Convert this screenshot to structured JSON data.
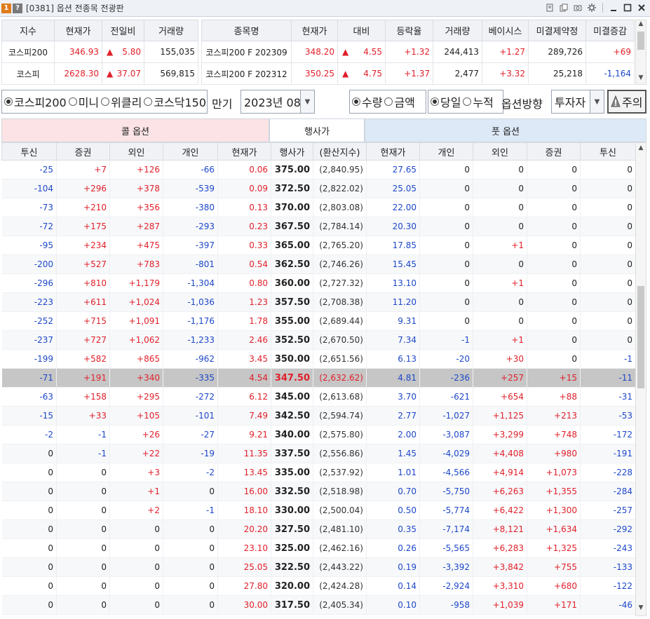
{
  "window": {
    "num_badge": "1",
    "help_badge": "?",
    "title": "[0381] 옵션 전종목 전광판",
    "icons": [
      "page-icon",
      "copy-icon",
      "camera-icon",
      "settings-icon",
      "minimize-icon",
      "maximize-icon",
      "close-icon"
    ]
  },
  "index_table": {
    "headers": [
      "지수",
      "현재가",
      "전일비",
      "거래량"
    ],
    "rows": [
      {
        "name": "코스피200",
        "price": "346.93",
        "arrow": "▲",
        "change": "5.80",
        "volume": "155,035"
      },
      {
        "name": "코스피",
        "price": "2628.30",
        "arrow": "▲",
        "change": "37.07",
        "volume": "569,815"
      }
    ]
  },
  "futures_table": {
    "headers": [
      "종목명",
      "현재가",
      "대비",
      "등락율",
      "거래량",
      "베이시스",
      "미결제약정",
      "미결증감"
    ],
    "rows": [
      {
        "name": "코스피200 F 202309",
        "price": "348.20",
        "arrow": "▲",
        "change": "4.55",
        "rate": "+1.32",
        "volume": "244,413",
        "basis": "+1.27",
        "oi": "289,726",
        "oi_change": "+69"
      },
      {
        "name": "코스피200 F 202312",
        "price": "350.25",
        "arrow": "▲",
        "change": "4.75",
        "rate": "+1.37",
        "volume": "2,477",
        "basis": "+3.32",
        "oi": "25,218",
        "oi_change": "-1,164"
      }
    ]
  },
  "controls": {
    "market_radios": [
      "코스피200",
      "미니",
      "위클리",
      "코스닥150"
    ],
    "expiry_label": "만기",
    "expiry_value": "2023년 08",
    "value_radios": [
      "수량",
      "금액"
    ],
    "period_radios": [
      "당일",
      "누적"
    ],
    "direction_label": "옵션방향",
    "investor_select": "투자자",
    "warning_button": "주의"
  },
  "sections": {
    "call": "콜 옵션",
    "strike": "행사가",
    "put": "풋 옵션"
  },
  "main_table": {
    "headers": [
      "투신",
      "증권",
      "외인",
      "개인",
      "현재가",
      "행사가",
      "(환산지수)",
      "현재가",
      "개인",
      "외인",
      "증권",
      "투신"
    ],
    "rows": [
      [
        "-25",
        "+7",
        "+126",
        "-66",
        "0.06",
        "375.00",
        "(2,840.95)",
        "27.65",
        "0",
        "0",
        "0",
        "0"
      ],
      [
        "-104",
        "+296",
        "+378",
        "-539",
        "0.09",
        "372.50",
        "(2,822.02)",
        "25.05",
        "0",
        "0",
        "0",
        "0"
      ],
      [
        "-73",
        "+210",
        "+356",
        "-380",
        "0.13",
        "370.00",
        "(2,803.08)",
        "22.00",
        "0",
        "0",
        "0",
        "0"
      ],
      [
        "-72",
        "+175",
        "+287",
        "-293",
        "0.23",
        "367.50",
        "(2,784.14)",
        "20.30",
        "0",
        "0",
        "0",
        "0"
      ],
      [
        "-95",
        "+234",
        "+475",
        "-397",
        "0.33",
        "365.00",
        "(2,765.20)",
        "17.85",
        "0",
        "+1",
        "0",
        "0"
      ],
      [
        "-200",
        "+527",
        "+783",
        "-801",
        "0.54",
        "362.50",
        "(2,746.26)",
        "15.45",
        "0",
        "0",
        "0",
        "0"
      ],
      [
        "-296",
        "+810",
        "+1,179",
        "-1,304",
        "0.80",
        "360.00",
        "(2,727.32)",
        "13.10",
        "0",
        "+1",
        "0",
        "0"
      ],
      [
        "-223",
        "+611",
        "+1,024",
        "-1,036",
        "1.23",
        "357.50",
        "(2,708.38)",
        "11.20",
        "0",
        "0",
        "0",
        "0"
      ],
      [
        "-252",
        "+715",
        "+1,091",
        "-1,176",
        "1.78",
        "355.00",
        "(2,689.44)",
        "9.31",
        "0",
        "0",
        "0",
        "0"
      ],
      [
        "-237",
        "+727",
        "+1,062",
        "-1,233",
        "2.46",
        "352.50",
        "(2,670.50)",
        "7.34",
        "-1",
        "+1",
        "0",
        "0"
      ],
      [
        "-199",
        "+582",
        "+865",
        "-962",
        "3.45",
        "350.00",
        "(2,651.56)",
        "6.13",
        "-20",
        "+30",
        "0",
        "-1"
      ],
      [
        "-71",
        "+191",
        "+340",
        "-335",
        "4.54",
        "347.50",
        "(2,632.62)",
        "4.81",
        "-236",
        "+257",
        "+15",
        "-11"
      ],
      [
        "-63",
        "+158",
        "+295",
        "-272",
        "6.12",
        "345.00",
        "(2,613.68)",
        "3.70",
        "-621",
        "+654",
        "+88",
        "-31"
      ],
      [
        "-15",
        "+33",
        "+105",
        "-101",
        "7.49",
        "342.50",
        "(2,594.74)",
        "2.77",
        "-1,027",
        "+1,125",
        "+213",
        "-53"
      ],
      [
        "-2",
        "-1",
        "+26",
        "-27",
        "9.21",
        "340.00",
        "(2,575.80)",
        "2.00",
        "-3,087",
        "+3,299",
        "+748",
        "-172"
      ],
      [
        "0",
        "-1",
        "+22",
        "-19",
        "11.35",
        "337.50",
        "(2,556.86)",
        "1.45",
        "-4,029",
        "+4,408",
        "+980",
        "-191"
      ],
      [
        "0",
        "0",
        "+3",
        "-2",
        "13.45",
        "335.00",
        "(2,537.92)",
        "1.01",
        "-4,566",
        "+4,914",
        "+1,073",
        "-228"
      ],
      [
        "0",
        "0",
        "+1",
        "0",
        "16.00",
        "332.50",
        "(2,518.98)",
        "0.70",
        "-5,750",
        "+6,263",
        "+1,355",
        "-284"
      ],
      [
        "0",
        "0",
        "+2",
        "-1",
        "18.10",
        "330.00",
        "(2,500.04)",
        "0.50",
        "-5,774",
        "+6,422",
        "+1,300",
        "-257"
      ],
      [
        "0",
        "0",
        "0",
        "0",
        "20.20",
        "327.50",
        "(2,481.10)",
        "0.35",
        "-7,174",
        "+8,121",
        "+1,634",
        "-292"
      ],
      [
        "0",
        "0",
        "0",
        "0",
        "23.10",
        "325.00",
        "(2,462.16)",
        "0.26",
        "-5,565",
        "+6,283",
        "+1,325",
        "-243"
      ],
      [
        "0",
        "0",
        "0",
        "0",
        "25.05",
        "322.50",
        "(2,443.22)",
        "0.19",
        "-3,392",
        "+3,842",
        "+755",
        "-133"
      ],
      [
        "0",
        "0",
        "0",
        "0",
        "27.80",
        "320.00",
        "(2,424.28)",
        "0.14",
        "-2,924",
        "+3,310",
        "+680",
        "-122"
      ],
      [
        "0",
        "0",
        "0",
        "0",
        "30.00",
        "317.50",
        "(2,405.34)",
        "0.10",
        "-958",
        "+1,039",
        "+171",
        "-46"
      ]
    ],
    "atm_strike": "347.50"
  },
  "colors": {
    "up": "#e0202a",
    "down": "#1d48c8",
    "call_header": "#fbe3e6",
    "put_header": "#dde9f7",
    "atm_row": "#c6c6c6"
  }
}
